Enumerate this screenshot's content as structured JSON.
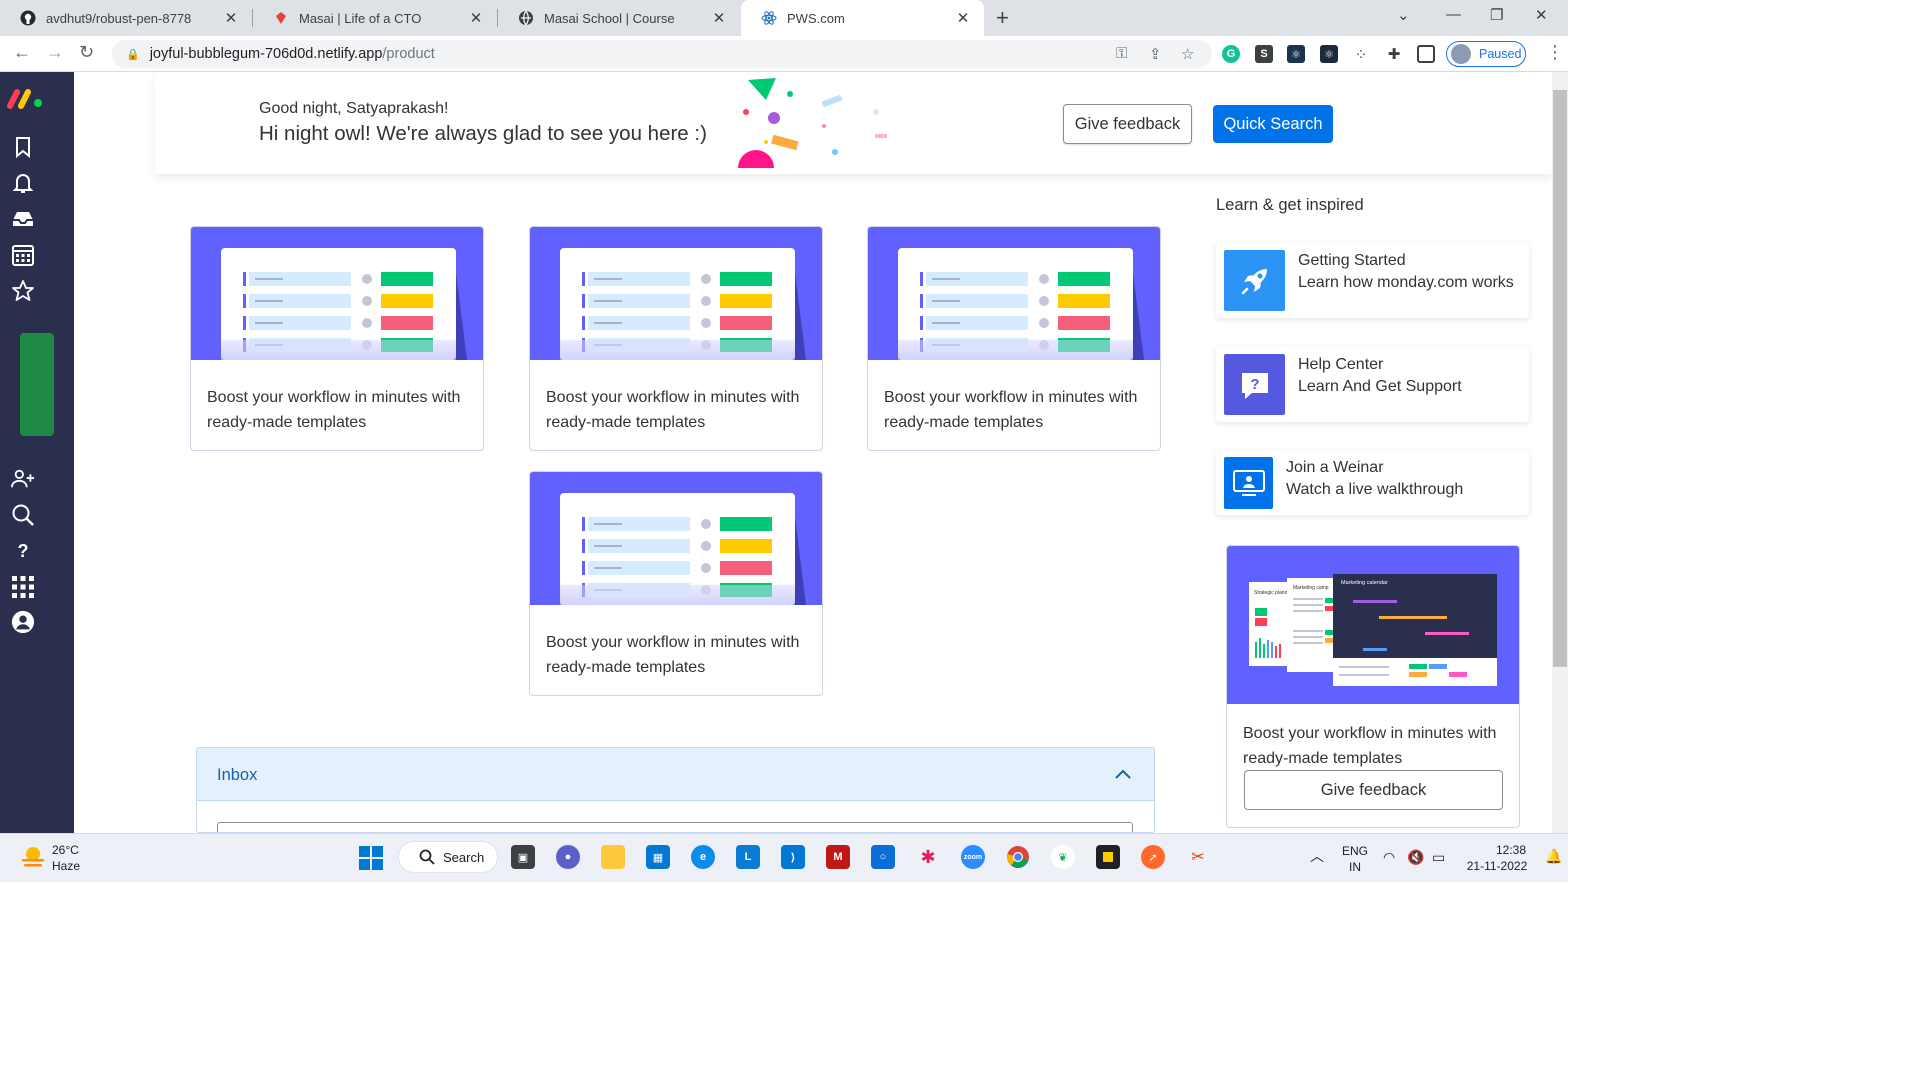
{
  "browser": {
    "tabs": [
      {
        "title": "avdhut9/robust-pen-8778",
        "icon": "github-icon"
      },
      {
        "title": "Masai | Life of a CTO",
        "icon": "masai-icon"
      },
      {
        "title": "Masai School | Course",
        "icon": "globe-icon"
      },
      {
        "title": "PWS.com",
        "icon": "react-icon",
        "active": true
      }
    ],
    "url_host": "joyful-bubblegum-706d0d.netlify.app",
    "url_path": "/product",
    "profile_status": "Paused"
  },
  "header": {
    "greeting": "Good night, Satyaprakash!",
    "message": "Hi night owl! We're always glad to see you here :)",
    "feedback_label": "Give feedback",
    "quick_search_label": "Quick Search"
  },
  "templates": [
    {
      "text": "Boost your workflow in minutes with ready-made templates"
    },
    {
      "text": "Boost your workflow in minutes with ready-made templates"
    },
    {
      "text": "Boost your workflow in minutes with ready-made templates"
    },
    {
      "text": "Boost your workflow in minutes with ready-made templates"
    }
  ],
  "learn": {
    "title": "Learn & get inspired",
    "items": [
      {
        "title": "Getting Started",
        "subtitle": "Learn how monday.com works",
        "icon": "rocket-icon",
        "color": "#2b93f3"
      },
      {
        "title": "Help Center",
        "subtitle": "Learn And Get Support",
        "icon": "help-chat-icon",
        "color": "#5559df"
      },
      {
        "title": "Join a Weinar",
        "subtitle": "Watch a live walkthrough",
        "icon": "webinar-icon",
        "color": "#0073ea"
      }
    ],
    "promo": {
      "text": "Boost your workflow in minutes with ready-made templates",
      "button": "Give feedback",
      "thumb_labels": [
        "Strategic plann",
        "Marketing camp",
        "Marketing calendar"
      ]
    }
  },
  "inbox": {
    "title": "Inbox"
  },
  "taskbar": {
    "weather_temp": "26°C",
    "weather_desc": "Haze",
    "search_label": "Search",
    "lang": "ENG",
    "region": "IN",
    "time": "12:38",
    "date": "21-11-2022"
  }
}
